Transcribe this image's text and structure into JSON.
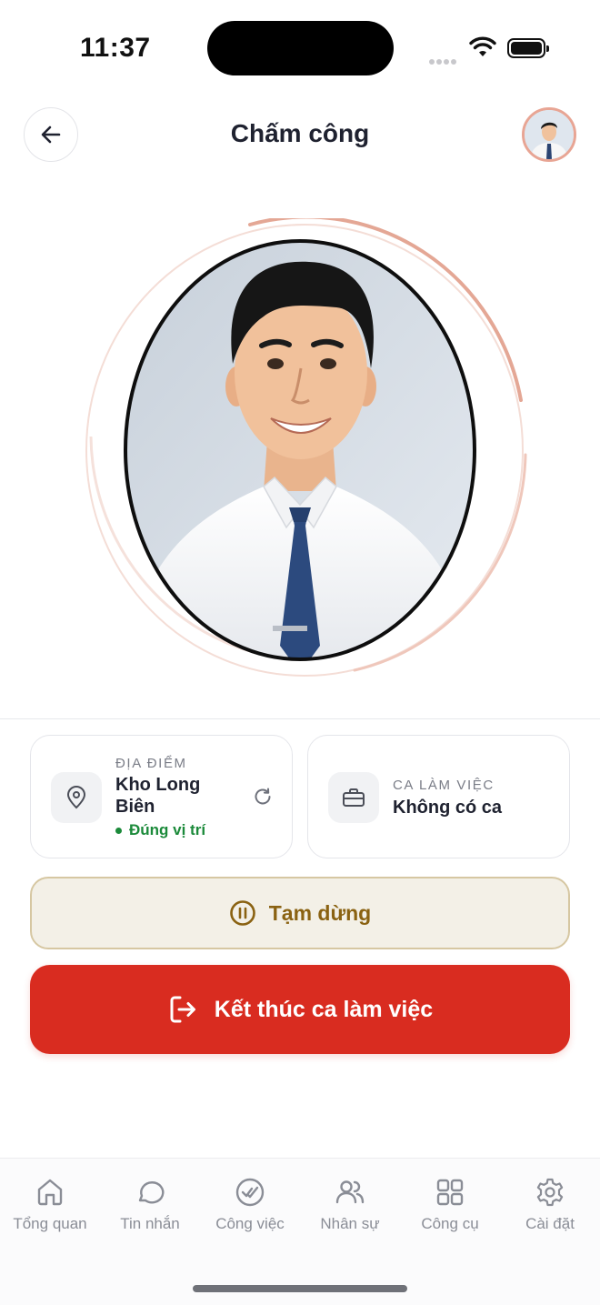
{
  "status_bar": {
    "time": "11:37"
  },
  "header": {
    "title": "Chấm công"
  },
  "location_card": {
    "label": "ĐỊA ĐIỂM",
    "value": "Kho Long Biên",
    "status": "Đúng vị trí",
    "status_color": "#1b8a3a"
  },
  "shift_card": {
    "label": "CA LÀM VIỆC",
    "value": "Không có ca"
  },
  "pause_button": {
    "label": "Tạm dừng",
    "color": "#8a6212"
  },
  "end_button": {
    "label": "Kết thúc ca làm việc",
    "color": "#d92c20"
  },
  "bottom_nav": {
    "items": [
      {
        "label": "Tổng quan",
        "icon": "home-icon"
      },
      {
        "label": "Tin nhắn",
        "icon": "chat-icon"
      },
      {
        "label": "Công việc",
        "icon": "task-check-icon"
      },
      {
        "label": "Nhân sự",
        "icon": "people-icon"
      },
      {
        "label": "Công cụ",
        "icon": "grid-icon"
      },
      {
        "label": "Cài đặt",
        "icon": "gear-icon"
      }
    ]
  },
  "colors": {
    "accent_ring": "#e8a594",
    "primary_red": "#d92c20",
    "pause_bg": "#f3f0e7"
  }
}
